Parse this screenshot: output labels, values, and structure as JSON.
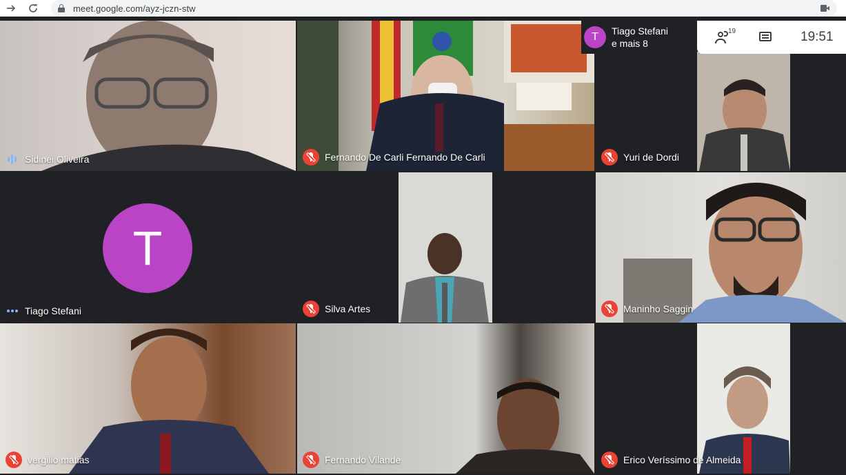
{
  "browser": {
    "url": "meet.google.com/ayz-jczn-stw",
    "icons": [
      "forward-arrow-icon",
      "reload-icon",
      "lock-icon",
      "camera-icon"
    ]
  },
  "overlay": {
    "presenter_initial": "T",
    "presenter_line1": "Tiago Stefani",
    "presenter_line2": "e mais 8",
    "participants_count": "19",
    "time": "19:51"
  },
  "tiles": [
    {
      "name": "Sidinei Oliveira",
      "status": "speaking"
    },
    {
      "name": "Fernando De Carli Fernando De Carli",
      "status": "muted"
    },
    {
      "name": "Yuri de Dordi",
      "status": "muted"
    },
    {
      "name": "Tiago Stefani",
      "status": "idle",
      "avatar_initial": "T"
    },
    {
      "name": "Silva Artes",
      "status": "muted"
    },
    {
      "name": "Maninho Saggin",
      "status": "muted"
    },
    {
      "name": "vergilio matias",
      "status": "muted"
    },
    {
      "name": "Fernando Vilande",
      "status": "muted"
    },
    {
      "name": "Erico Veríssimo de Almeida",
      "status": "muted"
    }
  ],
  "colors": {
    "background": "#202124",
    "mic_off": "#ea4335",
    "avatar": "#b944c5",
    "speaking": "#8ab4f8"
  }
}
